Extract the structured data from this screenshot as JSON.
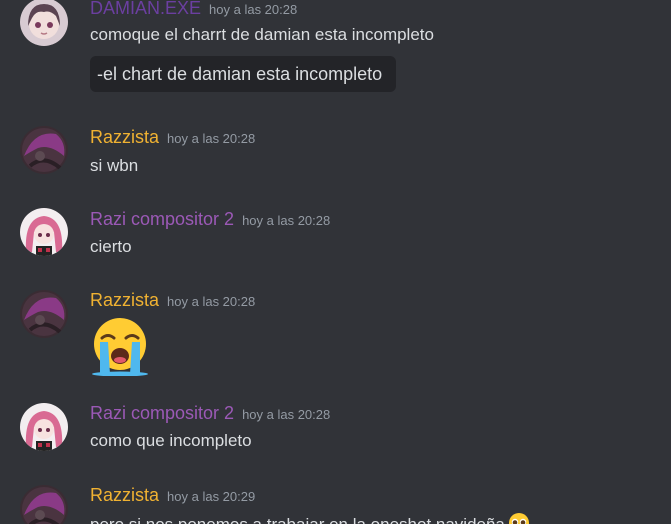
{
  "colors": {
    "background": "#313338",
    "text": "#dbdee1",
    "timestamp": "#949ba4",
    "quote_background": "#232428",
    "damian_name": "#6b3fa0",
    "razzista_name": "#f0b232",
    "razi_name": "#9b59b6"
  },
  "messages": [
    {
      "username": "DAMIAN.EXE",
      "timestamp": "hoy a las 20:28",
      "text": "comoque el charrt de damian esta incompleto",
      "quote": "-el chart de damian esta incompleto"
    },
    {
      "username": "Razzista",
      "timestamp": "hoy a las 20:28",
      "text": "si wbn"
    },
    {
      "username": "Razi compositor 2",
      "timestamp": "hoy a las 20:28",
      "text": "cierto"
    },
    {
      "username": "Razzista",
      "timestamp": "hoy a las 20:28",
      "emoji": "loudly-crying-face-icon"
    },
    {
      "username": "Razi compositor 2",
      "timestamp": "hoy a las 20:28",
      "text": "como que incompleto"
    },
    {
      "username": "Razzista",
      "timestamp": "hoy a las 20:29",
      "text": "pero si nos ponemos a trabajar en la oneshot navideña",
      "emoji": "pleading-face-icon"
    }
  ]
}
